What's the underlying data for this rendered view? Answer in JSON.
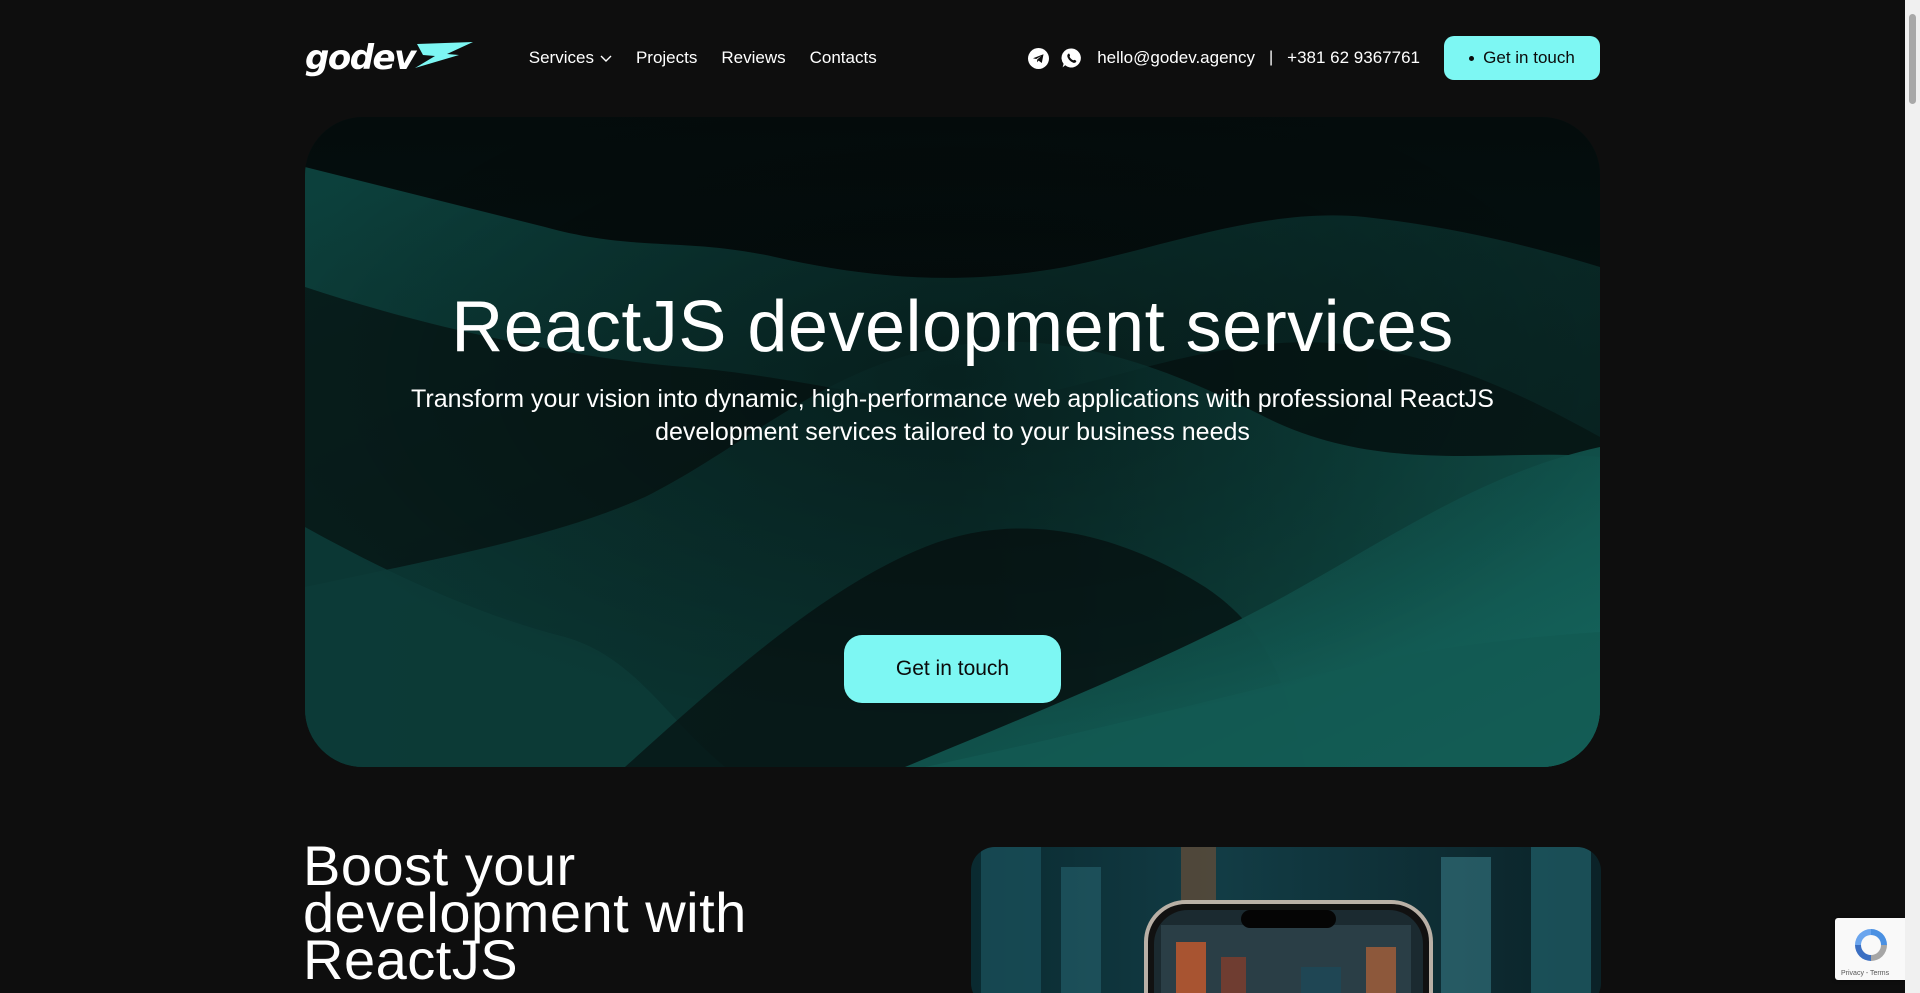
{
  "header": {
    "logo_text": "godev",
    "nav": [
      {
        "label": "Services",
        "has_dropdown": true
      },
      {
        "label": "Projects"
      },
      {
        "label": "Reviews"
      },
      {
        "label": "Contacts"
      }
    ],
    "social_icons": [
      "telegram-icon",
      "whatsapp-icon"
    ],
    "email": "hello@godev.agency",
    "separator": "|",
    "phone": "+381 62 9367761",
    "cta_label": "Get in touch"
  },
  "hero": {
    "title": "ReactJS development services",
    "subtitle_line1": "Transform your vision into dynamic, high-performance web applications with professional ReactJS",
    "subtitle_line2": "development services tailored to your business needs",
    "cta_label": "Get in touch"
  },
  "boost": {
    "title_line1": "Boost your",
    "title_line2": "development with",
    "title_line3": "ReactJS"
  },
  "recaptcha": {
    "links": "Privacy - Terms"
  },
  "colors": {
    "accent": "#7df7f3",
    "background": "#0e0e0e",
    "hero_dark": "#061716",
    "hero_teal": "#0f4d47"
  }
}
